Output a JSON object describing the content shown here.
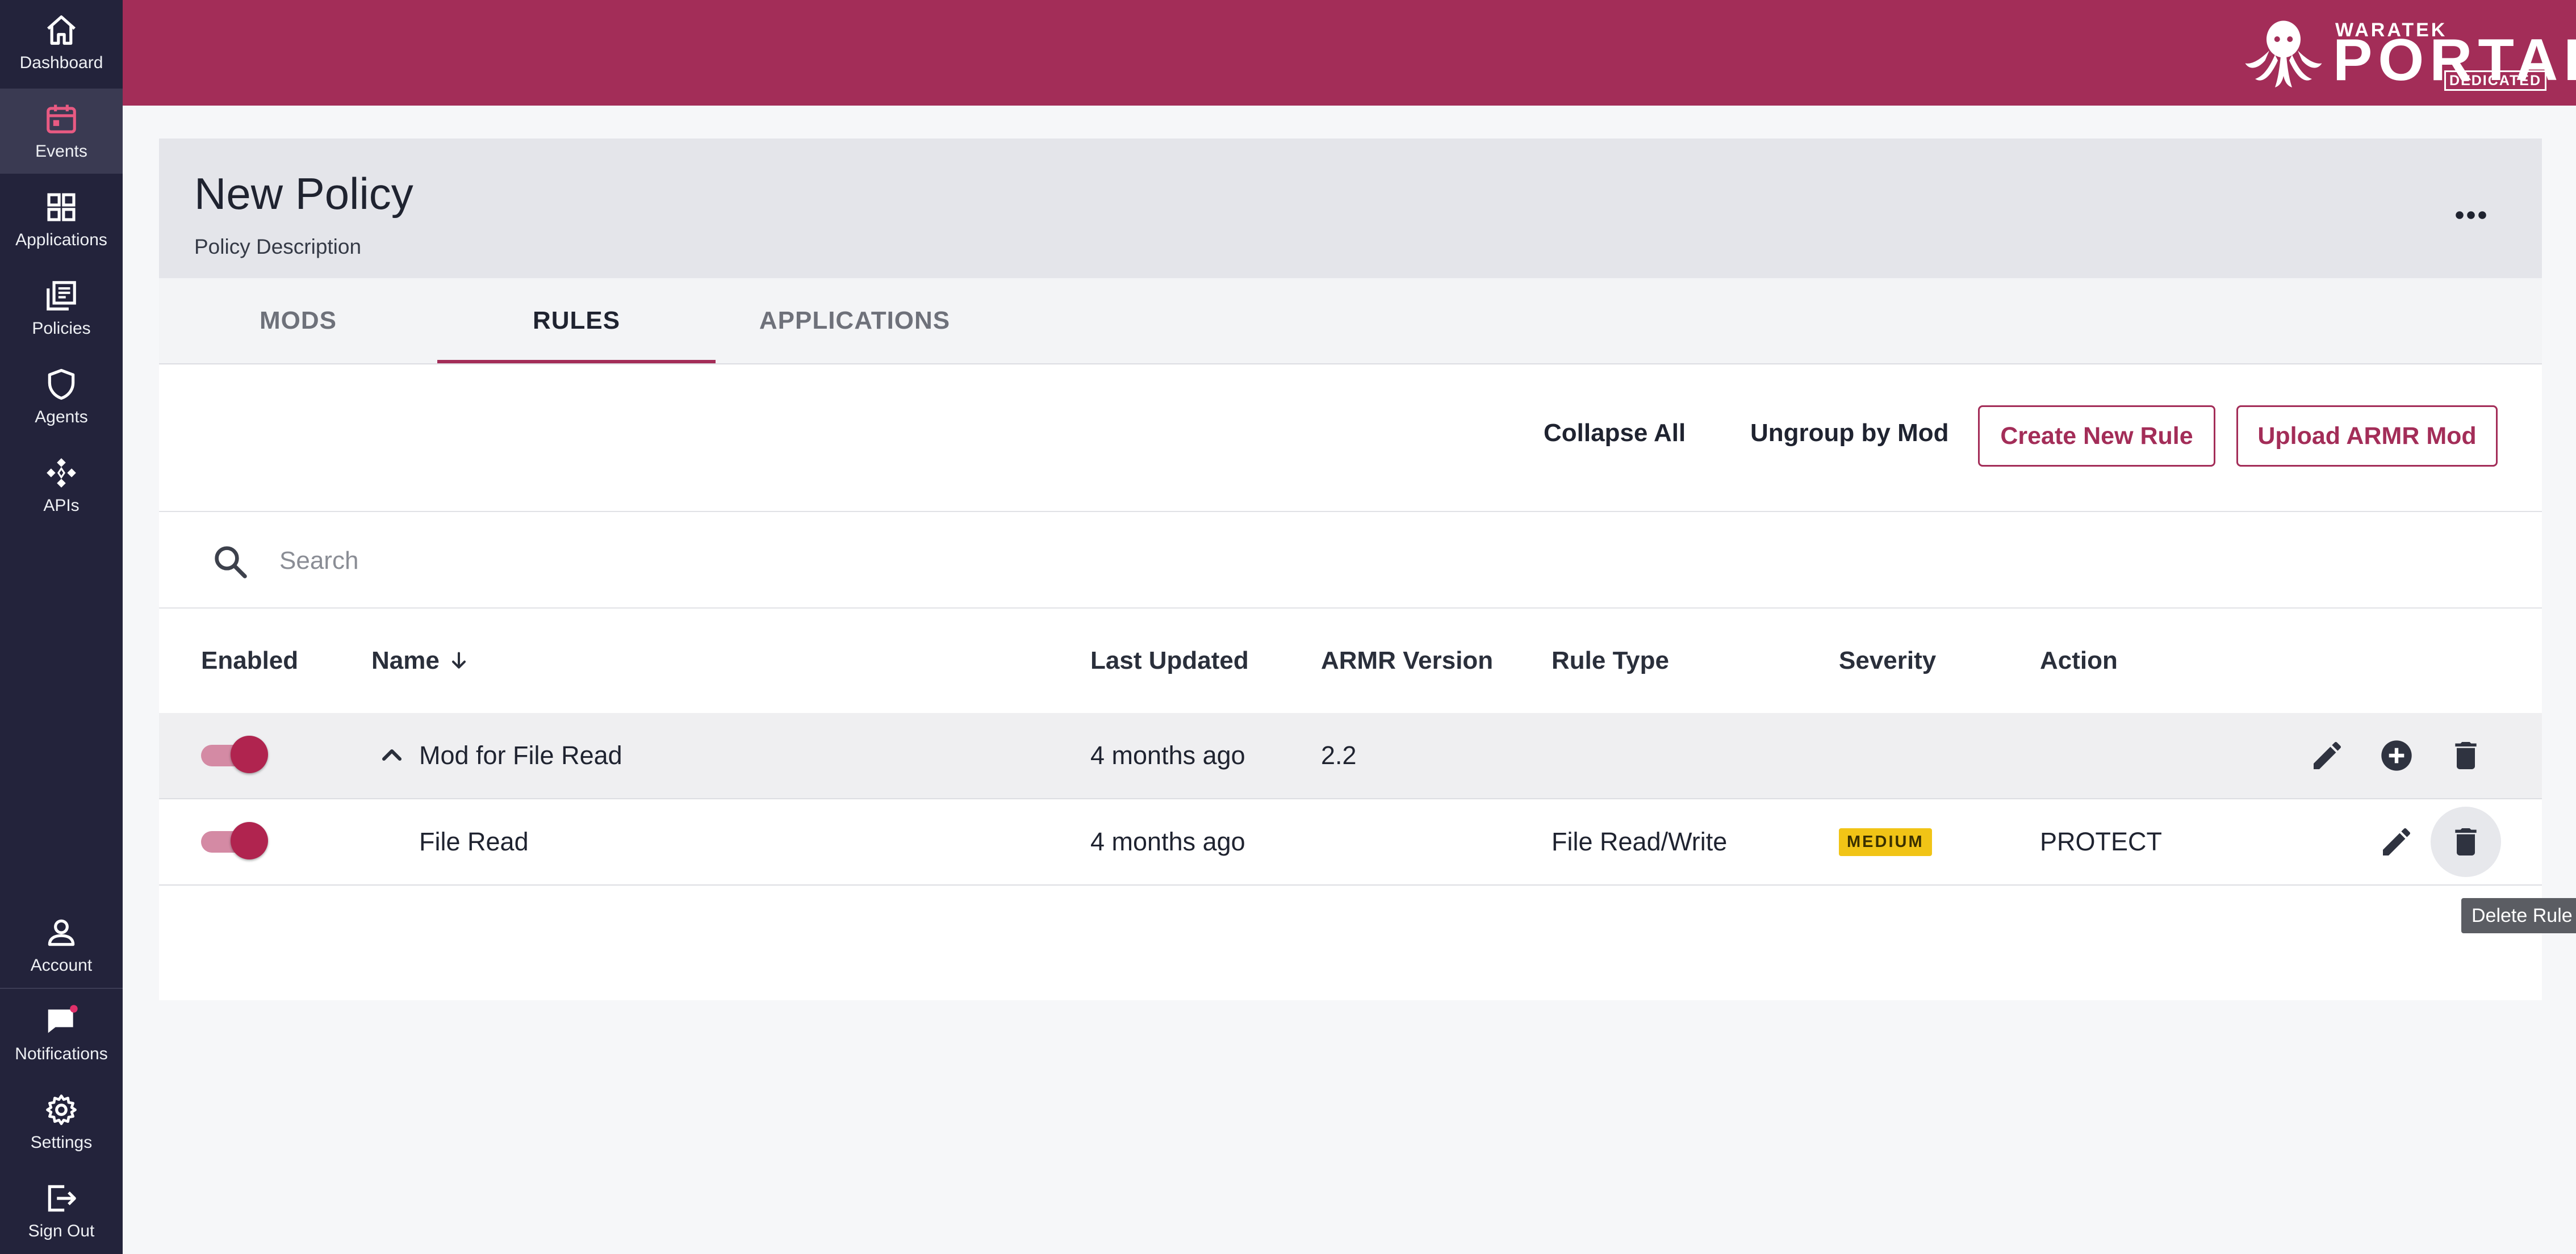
{
  "sidebar": {
    "items": [
      {
        "label": "Dashboard",
        "icon": "home-icon"
      },
      {
        "label": "Events",
        "icon": "calendar-icon",
        "active": true
      },
      {
        "label": "Applications",
        "icon": "grid-icon"
      },
      {
        "label": "Policies",
        "icon": "policies-icon"
      },
      {
        "label": "Agents",
        "icon": "shield-icon"
      },
      {
        "label": "APIs",
        "icon": "api-icon"
      }
    ],
    "bottom_items": [
      {
        "label": "Account",
        "icon": "person-icon"
      },
      {
        "label": "Notifications",
        "icon": "chat-icon",
        "has_dot": true
      },
      {
        "label": "Settings",
        "icon": "gear-icon"
      },
      {
        "label": "Sign Out",
        "icon": "sign-out-icon"
      }
    ]
  },
  "brand": {
    "small": "WARATEK",
    "name": "PORTAL",
    "edition": "DEDICATED"
  },
  "policy": {
    "title": "New Policy",
    "description": "Policy Description"
  },
  "tabs": [
    {
      "label": "MODS"
    },
    {
      "label": "RULES",
      "active": true
    },
    {
      "label": "APPLICATIONS"
    }
  ],
  "toolbar": {
    "collapse_all": "Collapse All",
    "ungroup": "Ungroup by Mod",
    "create_rule": "Create New Rule",
    "upload_mod": "Upload ARMR Mod"
  },
  "search": {
    "placeholder": "Search",
    "value": ""
  },
  "table": {
    "columns": {
      "enabled": "Enabled",
      "name": "Name",
      "last_updated": "Last Updated",
      "armr_version": "ARMR Version",
      "rule_type": "Rule Type",
      "severity": "Severity",
      "action": "Action"
    },
    "sort": {
      "column": "Name",
      "direction": "descending-arrow"
    },
    "rows": [
      {
        "kind": "group",
        "enabled": true,
        "expanded": true,
        "name": "Mod for File Read",
        "last_updated": "4 months ago",
        "armr_version": "2.2",
        "rule_type": "",
        "severity": "",
        "action": ""
      },
      {
        "kind": "rule",
        "enabled": true,
        "name": "File Read",
        "last_updated": "4 months ago",
        "armr_version": "",
        "rule_type": "File Read/Write",
        "severity": "MEDIUM",
        "action": "PROTECT"
      }
    ]
  },
  "tooltip": "Delete Rule",
  "colors": {
    "brand": "#a32d58",
    "sidebar": "#23233b",
    "severity_medium": "#f1c416"
  }
}
